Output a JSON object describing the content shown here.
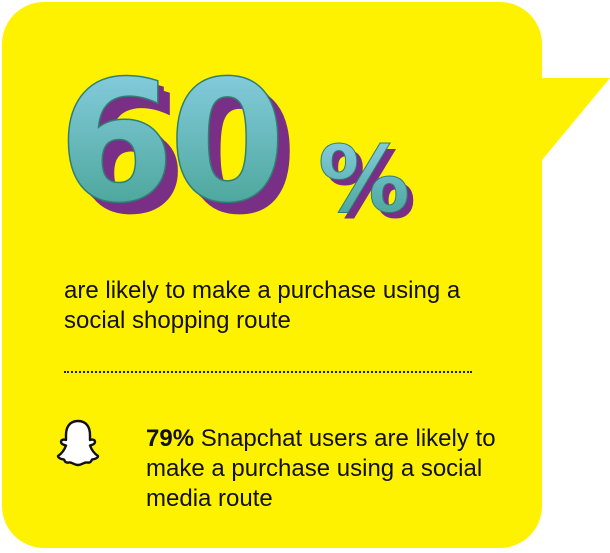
{
  "stat": {
    "number": "60",
    "symbol": "%"
  },
  "headline": "are likely to make a purchase using a social shopping route",
  "detail": {
    "highlight": "79%",
    "text": " Snapchat users are likely to make a purchase using a social media route"
  },
  "icons": {
    "ghost": "snapchat-ghost-icon"
  },
  "colors": {
    "background": "#fff200",
    "stat_fill_top": "#8fd3ea",
    "stat_fill_bottom": "#3f9e8c",
    "stat_shadow": "#7a2f86",
    "text": "#111111"
  }
}
